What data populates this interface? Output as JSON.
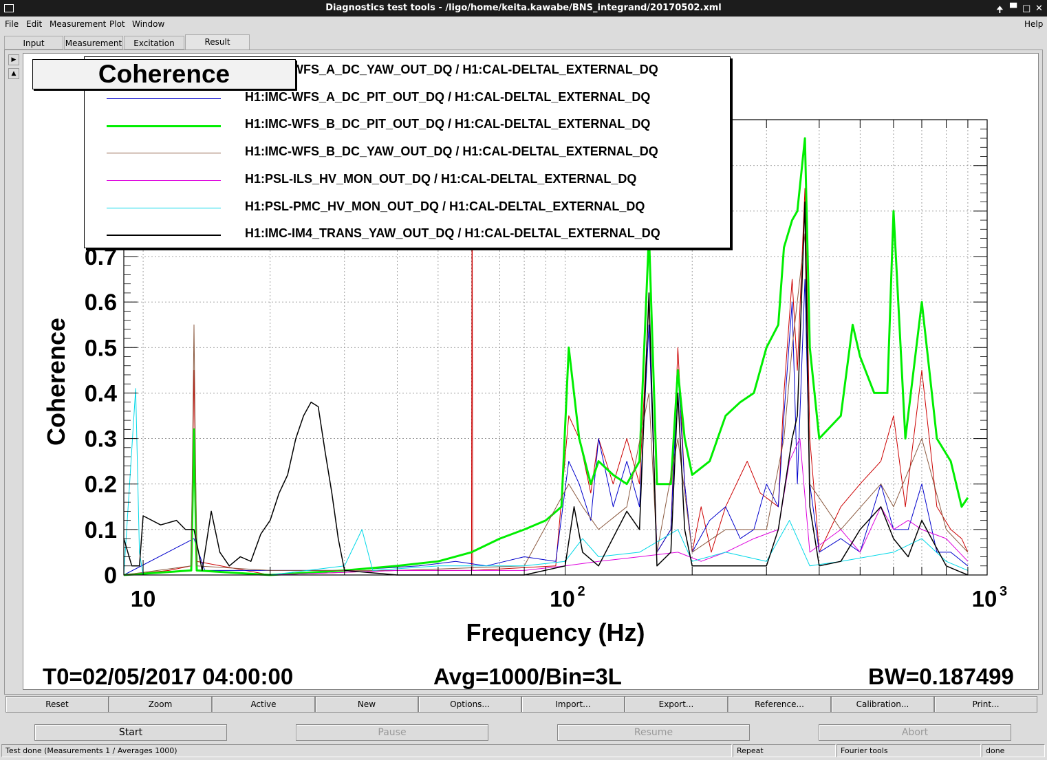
{
  "window": {
    "title": "Diagnostics test tools - /ligo/home/keita.kawabe/BNS_integrand/20170502.xml"
  },
  "menubar": {
    "items": [
      "File",
      "Edit",
      "Measurement",
      "Plot",
      "Window"
    ],
    "help": "Help"
  },
  "tabs": [
    {
      "label": "Input"
    },
    {
      "label": "Measurement"
    },
    {
      "label": "Excitation"
    },
    {
      "label": "Result",
      "active": true
    }
  ],
  "plot": {
    "title_box": "Coherence",
    "footer": {
      "t0": "T0=02/05/2017 04:00:00",
      "avg": "Avg=1000/Bin=3L",
      "bw": "BW=0.187499"
    }
  },
  "chart_data": {
    "type": "line",
    "xlabel": "Frequency (Hz)",
    "ylabel": "Coherence",
    "xscale": "log",
    "xlim": [
      9,
      1000
    ],
    "ylim": [
      0,
      1
    ],
    "x_tick_labels": [
      "10",
      "10^2",
      "10^3"
    ],
    "y_tick_labels": [
      "0",
      "0.1",
      "0.2",
      "0.3",
      "0.4",
      "0.5",
      "0.6",
      "0.7"
    ],
    "grid": true,
    "legend_position": "top-left",
    "series": [
      {
        "name": "H1:IMC-WFS_A_DC_YAW_OUT_DQ / H1:CAL-DELTAL_EXTERNAL_DQ",
        "color": "#cc0000",
        "width": 1,
        "points": [
          [
            9,
            0.0
          ],
          [
            11.5,
            0.01
          ],
          [
            13,
            0.02
          ],
          [
            13.2,
            0.45
          ],
          [
            13.4,
            0.03
          ],
          [
            20,
            0.0
          ],
          [
            40,
            0.01
          ],
          [
            60,
            0.01
          ],
          [
            60.2,
            0.95
          ],
          [
            60.4,
            0.01
          ],
          [
            95,
            0.02
          ],
          [
            102,
            0.35
          ],
          [
            108,
            0.3
          ],
          [
            115,
            0.18
          ],
          [
            120,
            0.3
          ],
          [
            130,
            0.2
          ],
          [
            140,
            0.3
          ],
          [
            150,
            0.2
          ],
          [
            158,
            0.6
          ],
          [
            165,
            0.05
          ],
          [
            178,
            0.1
          ],
          [
            185,
            0.5
          ],
          [
            192,
            0.2
          ],
          [
            200,
            0.05
          ],
          [
            210,
            0.15
          ],
          [
            222,
            0.05
          ],
          [
            240,
            0.15
          ],
          [
            270,
            0.25
          ],
          [
            290,
            0.18
          ],
          [
            320,
            0.15
          ],
          [
            330,
            0.4
          ],
          [
            345,
            0.65
          ],
          [
            355,
            0.45
          ],
          [
            370,
            0.85
          ],
          [
            380,
            0.3
          ],
          [
            400,
            0.05
          ],
          [
            450,
            0.15
          ],
          [
            500,
            0.2
          ],
          [
            560,
            0.25
          ],
          [
            600,
            0.35
          ],
          [
            640,
            0.15
          ],
          [
            700,
            0.45
          ],
          [
            760,
            0.15
          ],
          [
            820,
            0.1
          ],
          [
            870,
            0.08
          ],
          [
            900,
            0.05
          ]
        ]
      },
      {
        "name": "H1:IMC-WFS_A_DC_PIT_OUT_DQ / H1:CAL-DELTAL_EXTERNAL_DQ",
        "color": "#0000cc",
        "width": 1,
        "points": [
          [
            9,
            0.0
          ],
          [
            13.2,
            0.08
          ],
          [
            14,
            0.01
          ],
          [
            30,
            0.01
          ],
          [
            45,
            0.02
          ],
          [
            55,
            0.03
          ],
          [
            65,
            0.02
          ],
          [
            80,
            0.04
          ],
          [
            95,
            0.03
          ],
          [
            102,
            0.25
          ],
          [
            108,
            0.2
          ],
          [
            115,
            0.12
          ],
          [
            120,
            0.3
          ],
          [
            130,
            0.15
          ],
          [
            140,
            0.25
          ],
          [
            150,
            0.15
          ],
          [
            158,
            0.55
          ],
          [
            165,
            0.05
          ],
          [
            178,
            0.1
          ],
          [
            185,
            0.45
          ],
          [
            192,
            0.2
          ],
          [
            200,
            0.05
          ],
          [
            220,
            0.12
          ],
          [
            240,
            0.15
          ],
          [
            260,
            0.08
          ],
          [
            280,
            0.1
          ],
          [
            300,
            0.2
          ],
          [
            320,
            0.15
          ],
          [
            330,
            0.35
          ],
          [
            345,
            0.6
          ],
          [
            355,
            0.2
          ],
          [
            370,
            0.65
          ],
          [
            380,
            0.2
          ],
          [
            400,
            0.05
          ],
          [
            450,
            0.08
          ],
          [
            500,
            0.05
          ],
          [
            560,
            0.2
          ],
          [
            600,
            0.1
          ],
          [
            650,
            0.1
          ],
          [
            700,
            0.2
          ],
          [
            760,
            0.05
          ],
          [
            820,
            0.05
          ],
          [
            900,
            0.02
          ]
        ]
      },
      {
        "name": "H1:IMC-WFS_B_DC_PIT_OUT_DQ / H1:CAL-DELTAL_EXTERNAL_DQ",
        "color": "#00ee00",
        "width": 3,
        "points": [
          [
            9,
            0.0
          ],
          [
            13,
            0.01
          ],
          [
            13.2,
            0.32
          ],
          [
            13.4,
            0.01
          ],
          [
            20,
            0.0
          ],
          [
            30,
            0.01
          ],
          [
            40,
            0.02
          ],
          [
            50,
            0.03
          ],
          [
            60,
            0.05
          ],
          [
            70,
            0.08
          ],
          [
            80,
            0.1
          ],
          [
            90,
            0.12
          ],
          [
            98,
            0.15
          ],
          [
            102,
            0.5
          ],
          [
            108,
            0.3
          ],
          [
            115,
            0.2
          ],
          [
            120,
            0.25
          ],
          [
            130,
            0.22
          ],
          [
            140,
            0.2
          ],
          [
            150,
            0.25
          ],
          [
            158,
            0.75
          ],
          [
            165,
            0.2
          ],
          [
            178,
            0.2
          ],
          [
            185,
            0.45
          ],
          [
            192,
            0.3
          ],
          [
            200,
            0.22
          ],
          [
            220,
            0.25
          ],
          [
            240,
            0.35
          ],
          [
            260,
            0.38
          ],
          [
            280,
            0.4
          ],
          [
            300,
            0.5
          ],
          [
            320,
            0.55
          ],
          [
            330,
            0.72
          ],
          [
            345,
            0.78
          ],
          [
            355,
            0.8
          ],
          [
            370,
            0.96
          ],
          [
            380,
            0.5
          ],
          [
            400,
            0.3
          ],
          [
            450,
            0.35
          ],
          [
            480,
            0.55
          ],
          [
            500,
            0.48
          ],
          [
            540,
            0.4
          ],
          [
            580,
            0.4
          ],
          [
            600,
            0.8
          ],
          [
            640,
            0.3
          ],
          [
            700,
            0.6
          ],
          [
            760,
            0.3
          ],
          [
            820,
            0.25
          ],
          [
            870,
            0.15
          ],
          [
            900,
            0.17
          ]
        ]
      },
      {
        "name": "H1:IMC-WFS_B_DC_YAW_OUT_DQ / H1:CAL-DELTAL_EXTERNAL_DQ",
        "color": "#8b5a40",
        "width": 1,
        "points": [
          [
            9,
            0.0
          ],
          [
            13,
            0.02
          ],
          [
            13.2,
            0.55
          ],
          [
            13.4,
            0.02
          ],
          [
            20,
            0.01
          ],
          [
            40,
            0.01
          ],
          [
            80,
            0.02
          ],
          [
            102,
            0.2
          ],
          [
            110,
            0.15
          ],
          [
            120,
            0.1
          ],
          [
            140,
            0.15
          ],
          [
            158,
            0.4
          ],
          [
            165,
            0.05
          ],
          [
            185,
            0.3
          ],
          [
            200,
            0.05
          ],
          [
            240,
            0.1
          ],
          [
            300,
            0.1
          ],
          [
            330,
            0.3
          ],
          [
            345,
            0.5
          ],
          [
            370,
            0.75
          ],
          [
            380,
            0.2
          ],
          [
            450,
            0.1
          ],
          [
            560,
            0.2
          ],
          [
            600,
            0.15
          ],
          [
            700,
            0.3
          ],
          [
            800,
            0.1
          ],
          [
            900,
            0.05
          ]
        ]
      },
      {
        "name": "H1:PSL-ILS_HV_MON_OUT_DQ / H1:CAL-DELTAL_EXTERNAL_DQ",
        "color": "#dd00dd",
        "width": 1,
        "points": [
          [
            9,
            0.0
          ],
          [
            20,
            0.0
          ],
          [
            40,
            0.01
          ],
          [
            80,
            0.01
          ],
          [
            100,
            0.02
          ],
          [
            120,
            0.03
          ],
          [
            150,
            0.04
          ],
          [
            185,
            0.05
          ],
          [
            210,
            0.03
          ],
          [
            240,
            0.05
          ],
          [
            280,
            0.08
          ],
          [
            320,
            0.1
          ],
          [
            340,
            0.25
          ],
          [
            360,
            0.3
          ],
          [
            380,
            0.05
          ],
          [
            450,
            0.1
          ],
          [
            500,
            0.05
          ],
          [
            560,
            0.15
          ],
          [
            600,
            0.1
          ],
          [
            650,
            0.12
          ],
          [
            700,
            0.1
          ],
          [
            800,
            0.08
          ],
          [
            900,
            0.03
          ]
        ]
      },
      {
        "name": "H1:PSL-PMC_HV_MON_OUT_DQ / H1:CAL-DELTAL_EXTERNAL_DQ",
        "color": "#00d8e8",
        "width": 1,
        "points": [
          [
            9,
            0.0
          ],
          [
            9.6,
            0.41
          ],
          [
            9.8,
            0.05
          ],
          [
            10,
            0.0
          ],
          [
            20,
            0.0
          ],
          [
            30,
            0.02
          ],
          [
            33,
            0.1
          ],
          [
            35,
            0.01
          ],
          [
            50,
            0.02
          ],
          [
            80,
            0.02
          ],
          [
            100,
            0.03
          ],
          [
            110,
            0.08
          ],
          [
            120,
            0.04
          ],
          [
            150,
            0.05
          ],
          [
            185,
            0.1
          ],
          [
            200,
            0.03
          ],
          [
            240,
            0.05
          ],
          [
            300,
            0.03
          ],
          [
            340,
            0.12
          ],
          [
            380,
            0.02
          ],
          [
            450,
            0.03
          ],
          [
            600,
            0.05
          ],
          [
            700,
            0.08
          ],
          [
            800,
            0.03
          ],
          [
            900,
            0.01
          ]
        ]
      },
      {
        "name": "H1:IMC-IM4_TRANS_YAW_OUT_DQ / H1:CAL-DELTAL_EXTERNAL_DQ",
        "color": "#000000",
        "width": 1.5,
        "points": [
          [
            9,
            0.08
          ],
          [
            9.4,
            0.02
          ],
          [
            9.8,
            0.02
          ],
          [
            10,
            0.13
          ],
          [
            11,
            0.11
          ],
          [
            12,
            0.12
          ],
          [
            12.6,
            0.1
          ],
          [
            13.2,
            0.1
          ],
          [
            13.8,
            0.01
          ],
          [
            14.5,
            0.14
          ],
          [
            15.2,
            0.05
          ],
          [
            16,
            0.02
          ],
          [
            17,
            0.04
          ],
          [
            18,
            0.03
          ],
          [
            19,
            0.09
          ],
          [
            20,
            0.12
          ],
          [
            21,
            0.18
          ],
          [
            22,
            0.22
          ],
          [
            23,
            0.3
          ],
          [
            24,
            0.35
          ],
          [
            25,
            0.38
          ],
          [
            26,
            0.37
          ],
          [
            27,
            0.27
          ],
          [
            28,
            0.18
          ],
          [
            29,
            0.08
          ],
          [
            30,
            0.01
          ],
          [
            40,
            0.0
          ],
          [
            80,
            0.0
          ],
          [
            100,
            0.02
          ],
          [
            105,
            0.15
          ],
          [
            110,
            0.05
          ],
          [
            120,
            0.02
          ],
          [
            140,
            0.14
          ],
          [
            150,
            0.1
          ],
          [
            158,
            0.62
          ],
          [
            165,
            0.02
          ],
          [
            178,
            0.05
          ],
          [
            185,
            0.4
          ],
          [
            192,
            0.1
          ],
          [
            200,
            0.02
          ],
          [
            240,
            0.02
          ],
          [
            300,
            0.02
          ],
          [
            320,
            0.1
          ],
          [
            345,
            0.3
          ],
          [
            355,
            0.35
          ],
          [
            370,
            0.82
          ],
          [
            380,
            0.15
          ],
          [
            400,
            0.02
          ],
          [
            450,
            0.03
          ],
          [
            500,
            0.1
          ],
          [
            560,
            0.15
          ],
          [
            600,
            0.08
          ],
          [
            650,
            0.04
          ],
          [
            700,
            0.12
          ],
          [
            800,
            0.02
          ],
          [
            900,
            0.0
          ]
        ]
      }
    ]
  },
  "plot_buttons": [
    "Reset",
    "Zoom",
    "Active",
    "New",
    "Options...",
    "Import...",
    "Export...",
    "Reference...",
    "Calibration...",
    "Print..."
  ],
  "control_buttons": [
    {
      "label": "Start",
      "enabled": true
    },
    {
      "label": "Pause",
      "enabled": false
    },
    {
      "label": "Resume",
      "enabled": false
    },
    {
      "label": "Abort",
      "enabled": false
    }
  ],
  "status": {
    "main": "Test done (Measurements 1 / Averages 1000)",
    "repeat": "Repeat",
    "tools": "Fourier tools",
    "state": "done"
  }
}
